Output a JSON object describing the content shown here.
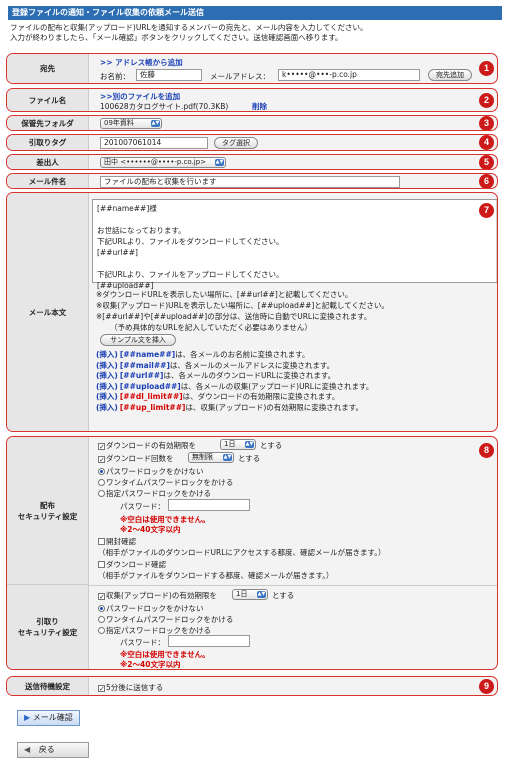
{
  "header": {
    "title": "登録ファイルの通知・ファイル収集の依頼メール送信",
    "intro_line1": "ファイルの配布と収集(アップロード)URLを通知するメンバーの宛先と、メール内容を入力してください。",
    "intro_line2": "入力が終わりましたら、「メール確認」ボタンをクリックしてください。送信確認画面へ移ります。"
  },
  "badges": [
    "1",
    "2",
    "3",
    "4",
    "5",
    "6",
    "7",
    "8",
    "9"
  ],
  "recipient": {
    "label": "宛先",
    "address_book_link": ">> アドレス帳から追加",
    "name_label": "お名前：",
    "name_value": "佐藤",
    "email_label": "メールアドレス：",
    "email_value": "k•••••@•••-p.co.jp",
    "add_button": "宛先追加"
  },
  "file": {
    "label": "ファイル名",
    "add_link": ">>別のファイルを追加",
    "file_name": "100628カタログサイト.pdf(70.3KB)",
    "delete_link": "削除"
  },
  "folder": {
    "label": "保管先フォルダ",
    "selected": "09年資料"
  },
  "tag": {
    "label": "引取りタグ",
    "value": "201007061014",
    "select_button": "タグ選択"
  },
  "sender": {
    "label": "差出人",
    "selected": "田中 <••••••@••••-p.co.jp>"
  },
  "subject": {
    "label": "メール件名",
    "value": "ファイルの配布と収集を行います"
  },
  "body": {
    "label": "メール本文",
    "text": "[##name##]様\n\nお世話になっております。\n下記URLより、ファイルをダウンロードしてください。\n[##url##]\n\n下記URLより、ファイルをアップロードしてください。\n[##upload##]",
    "note1": "※ダウンロードURLを表示したい場所に、[##url##]と記載してください。",
    "note2": "※収集(アップロード)URLを表示したい場所に、[##upload##]と記載してください。",
    "note3": "※[##url##]や[##upload##]の部分は、送信時に自動でURLに変換されます。",
    "note4": "（予め具体的なURLを記入していただく必要はありません）",
    "sample_button": "サンプル文を挿入",
    "inserts": [
      {
        "tag_open": "(挿入)",
        "code": "[##name##]",
        "desc": "は、各メールのお名前に変換されます。",
        "red": false
      },
      {
        "tag_open": "(挿入)",
        "code": "[##mail##]",
        "desc": "は、各メールのメールアドレスに変換されます。",
        "red": false
      },
      {
        "tag_open": "(挿入)",
        "code": "[##url##]",
        "desc": "は、各メールのダウンロードURLに変換されます。",
        "red": false
      },
      {
        "tag_open": "(挿入)",
        "code": "[##upload##]",
        "desc": "は、各メールの収集(アップロード)URLに変換されます。",
        "red": false
      },
      {
        "tag_open": "(挿入)",
        "code": "[##dl_limit##]",
        "desc": "は、ダウンロードの有効期限に変換されます。",
        "red": true
      },
      {
        "tag_open": "(挿入)",
        "code": "[##up_limit##]",
        "desc": "は、収集(アップロード)の有効期限に変換されます。",
        "red": true
      }
    ]
  },
  "dist_security": {
    "label": "配布\nセキュリティ設定",
    "dl_limit_prefix": "ダウンロードの有効期限を",
    "dl_limit_value": "1日",
    "dl_limit_suffix": "とする",
    "dl_count_prefix": "ダウンロード回数を",
    "dl_count_value": "無制限",
    "dl_count_suffix": "とする",
    "pw_none": "パスワードロックをかけない",
    "pw_onetime": "ワンタイムパスワードロックをかける",
    "pw_fixed": "指定パスワードロックをかける",
    "pw_label": "パスワード：",
    "pw_warn1": "※空白は使用できません。",
    "pw_warn2": "※2〜40文字以内",
    "open_confirm": "開封確認",
    "open_confirm_note": "（相手がファイルのダウンロードURLにアクセスする都度、確認メールが届きます。）",
    "dl_confirm": "ダウンロード確認",
    "dl_confirm_note": "（相手がファイルをダウンロードする都度、確認メールが届きます。）"
  },
  "up_security": {
    "label": "引取り\nセキュリティ設定",
    "up_limit_prefix": "収集(アップロード)の有効期限を",
    "up_limit_value": "1日",
    "up_limit_suffix": "とする",
    "pw_none": "パスワードロックをかけない",
    "pw_onetime": "ワンタイムパスワードロックをかける",
    "pw_fixed": "指定パスワードロックをかける",
    "pw_label": "パスワード：",
    "pw_warn1": "※空白は使用できません。",
    "pw_warn2": "※2〜40文字以内"
  },
  "delay": {
    "label": "送信待機設定",
    "option": "5分後に送信する"
  },
  "actions": {
    "confirm": "メール確認",
    "back": "戻る"
  }
}
